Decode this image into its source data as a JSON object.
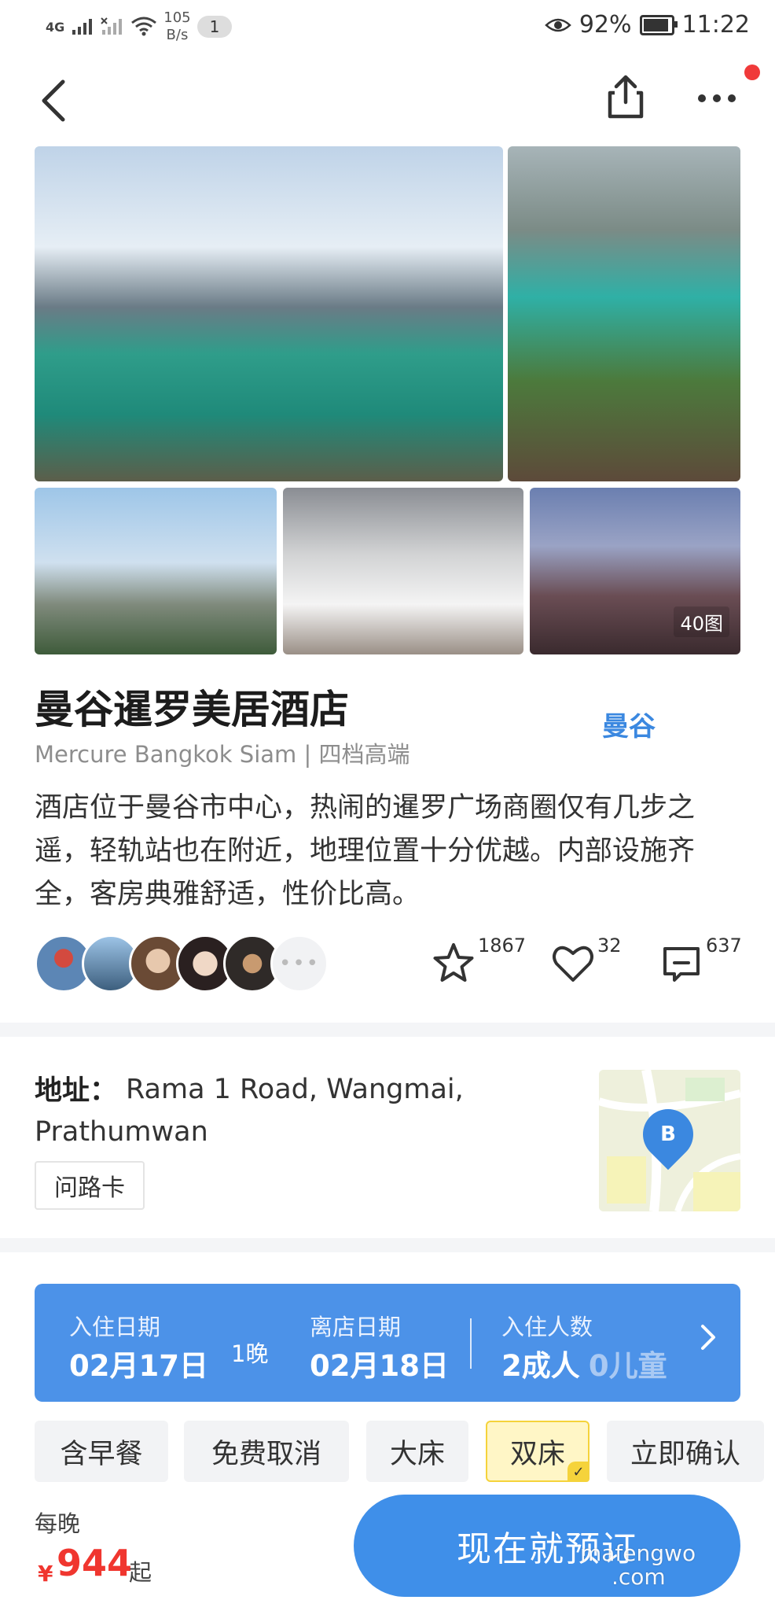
{
  "status_bar": {
    "network_4g": "4G",
    "speed_value": "105",
    "speed_unit": "B/s",
    "notification_count": "1",
    "battery_percent": "92%",
    "battery_level": 0.92,
    "time": "11:22"
  },
  "nav": {
    "back_icon": "back-arrow-icon",
    "share_icon": "share-icon",
    "more_icon": "more-dots-icon",
    "notification_dot_color": "#f03a3a"
  },
  "gallery": {
    "photo_count": "40图"
  },
  "hotel": {
    "name": "曼谷暹罗美居酒店",
    "city": "曼谷",
    "subtitle": "Mercure Bangkok Siam | 四档高端",
    "description": "酒店位于曼谷市中心，热闹的暹罗广场商圈仅有几步之遥，轻轨站也在附近，地理位置十分优越。内部设施齐全，客房典雅舒适，性价比高。"
  },
  "stats": {
    "favorites": "1867",
    "likes": "32",
    "comments": "637"
  },
  "address": {
    "label": "地址：",
    "text": "Rama 1 Road, Wangmai, Prathumwan",
    "ask_card_label": "问路卡",
    "map_pin_letter": "B"
  },
  "booking": {
    "checkin_label": "入住日期",
    "checkin_date": "02月17日",
    "nights": "1晚",
    "checkout_label": "离店日期",
    "checkout_date": "02月18日",
    "guests_label": "入住人数",
    "adults": "2成人",
    "children": "0儿童"
  },
  "filters": [
    {
      "label": "含早餐",
      "selected": false
    },
    {
      "label": "免费取消",
      "selected": false
    },
    {
      "label": "大床",
      "selected": false
    },
    {
      "label": "双床",
      "selected": true
    },
    {
      "label": "立即确认",
      "selected": false
    }
  ],
  "price": {
    "per_night_label": "每晚",
    "currency": "¥",
    "value": "944",
    "suffix": "起"
  },
  "cta": {
    "book_now": "现在就预订"
  },
  "watermark": {
    "line1": "mafengwo",
    "line2": ".com"
  },
  "colors": {
    "accent_blue": "#3f8fe9",
    "price_red": "#f0362f",
    "selected_yellow": "#f5d33b"
  }
}
